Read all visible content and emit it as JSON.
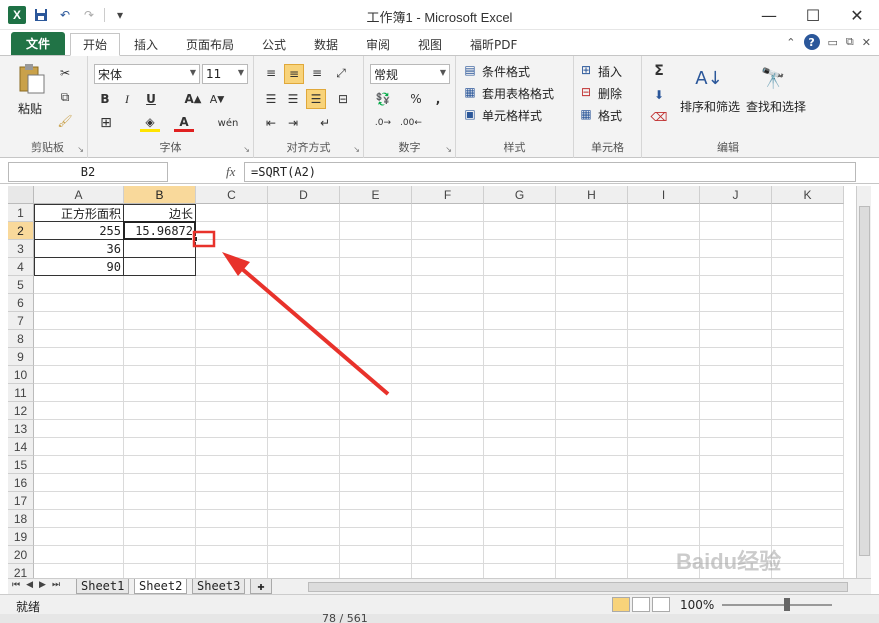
{
  "window": {
    "title": "工作簿1 - Microsoft Excel",
    "app_logo": "X",
    "minimize": "—",
    "maximize": "☐",
    "close": "✕"
  },
  "tabs": {
    "file": "文件",
    "items": [
      "开始",
      "插入",
      "页面布局",
      "公式",
      "数据",
      "审阅",
      "视图",
      "福昕PDF"
    ],
    "active": "开始"
  },
  "ribbon": {
    "clipboard": {
      "label": "剪贴板",
      "paste": "粘贴"
    },
    "font": {
      "label": "字体",
      "font_name": "宋体",
      "font_size": "11",
      "bold": "B",
      "italic": "I",
      "underline": "U"
    },
    "alignment": {
      "label": "对齐方式"
    },
    "number": {
      "label": "数字",
      "format": "常规"
    },
    "styles": {
      "label": "样式",
      "conditional": "条件格式",
      "table": "套用表格格式",
      "cell_styles": "单元格样式"
    },
    "cells": {
      "label": "单元格",
      "insert": "插入",
      "delete": "删除",
      "format": "格式"
    },
    "editing": {
      "label": "编辑",
      "sort_filter": "排序和筛选",
      "find_select": "查找和选择",
      "sigma": "Σ"
    }
  },
  "formula_bar": {
    "name_box": "B2",
    "fx": "fx",
    "formula": "=SQRT(A2)"
  },
  "grid": {
    "columns": [
      "A",
      "B",
      "C",
      "D",
      "E",
      "F",
      "G",
      "H",
      "I",
      "J",
      "K"
    ],
    "selected_col": "B",
    "selected_row": "2",
    "rows": [
      "1",
      "2",
      "3",
      "4",
      "5",
      "6",
      "7",
      "8",
      "9",
      "10",
      "11",
      "12",
      "13",
      "14",
      "15",
      "16",
      "17",
      "18",
      "19",
      "20",
      "21"
    ],
    "cells": {
      "A1": "正方形面积",
      "B1": "边长",
      "A2": "255",
      "B2": "15.96872",
      "A3": "36",
      "A4": "90"
    }
  },
  "sheets": {
    "tabs": [
      "Sheet1",
      "Sheet2",
      "Sheet3"
    ],
    "active": "Sheet2"
  },
  "status": {
    "ready": "就绪",
    "zoom": "100%"
  },
  "reader": {
    "page_counter": "78 / 561"
  },
  "watermark": "Baidu经验",
  "colors": {
    "accent_green": "#217346",
    "selection": "#f8d37a",
    "arrow_red": "#e8322b"
  }
}
